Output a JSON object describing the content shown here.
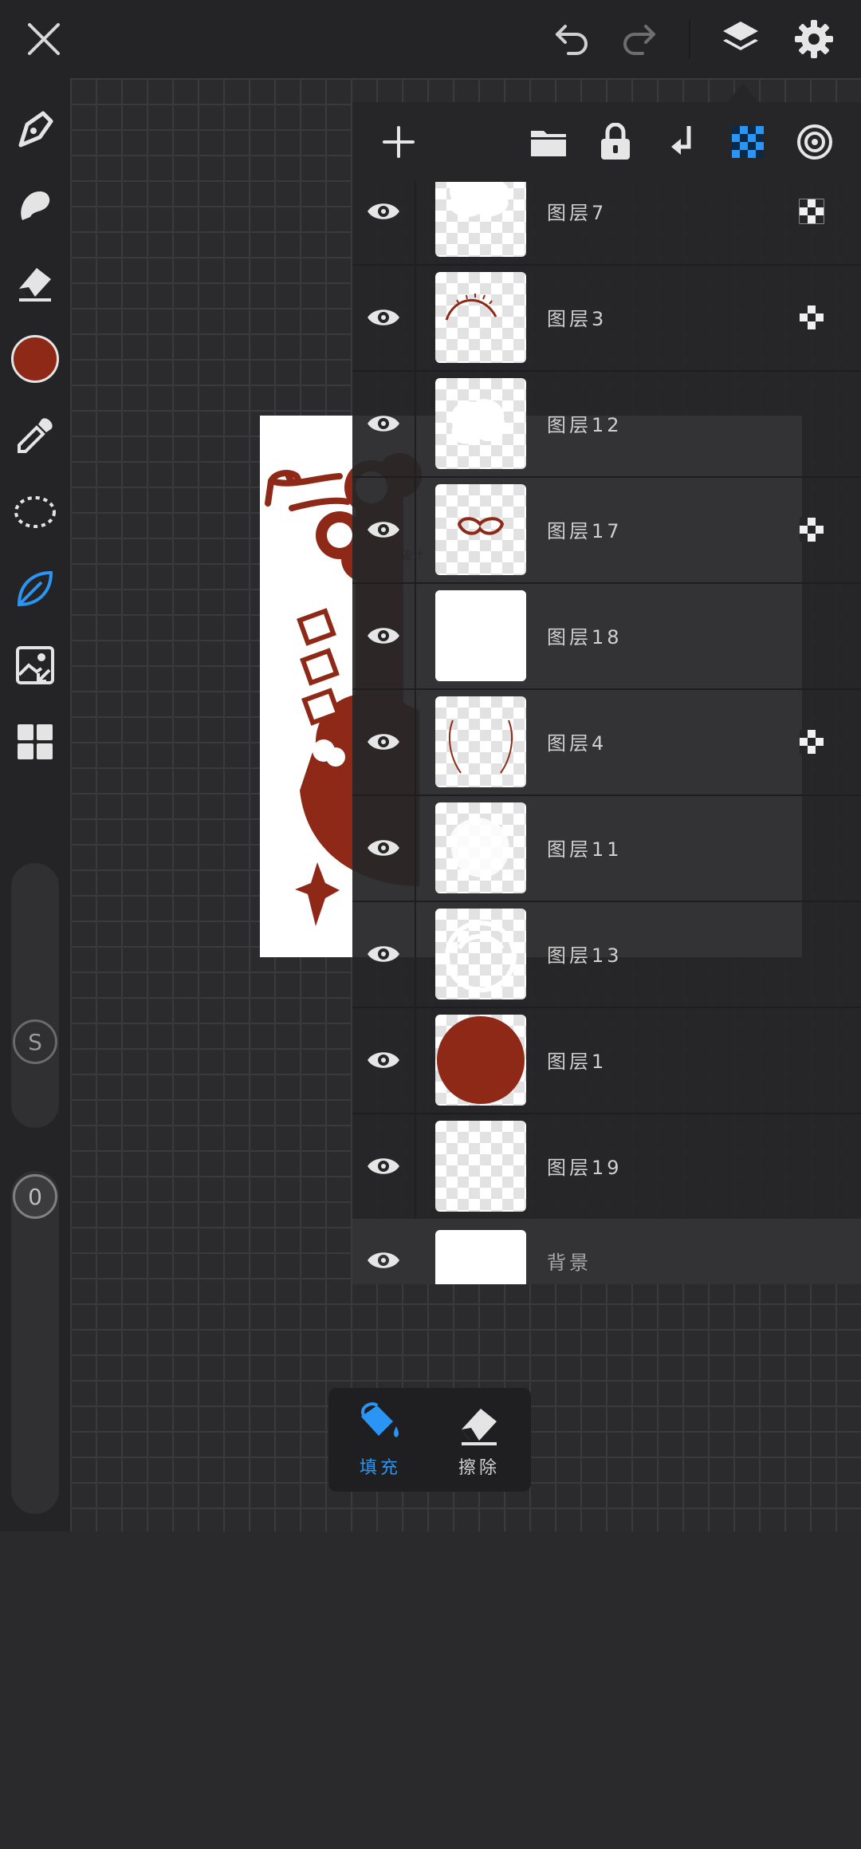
{
  "top_bar": {
    "icons": [
      "close-icon",
      "undo-icon",
      "redo-icon",
      "layers-icon",
      "settings-icon"
    ]
  },
  "colors": {
    "accent": "#2a95f4",
    "current_color": "#8e2817",
    "art_red": "#8e2817",
    "panel_bg": "#262628",
    "toolbar_bg": "#242426"
  },
  "left_toolbar": {
    "tools": [
      "brush-icon",
      "smudge-icon",
      "eraser-icon",
      "color-swatch",
      "eyedropper-icon",
      "lasso-select-icon",
      "leaf-fill-icon",
      "image-import-icon",
      "gallery-grid-icon"
    ],
    "size_slider_label": "S",
    "opacity_slider_label": "0"
  },
  "layers_panel": {
    "toolbar_icons": [
      "add-layer-icon",
      "folder-icon",
      "lock-icon",
      "merge-down-icon",
      "alpha-lock-icon",
      "layer-properties-icon"
    ],
    "layers": [
      {
        "name": "图层7",
        "alpha_locked": true
      },
      {
        "name": "图层3",
        "alpha_locked": true
      },
      {
        "name": "图层12",
        "alpha_locked": false
      },
      {
        "name": "图层17",
        "alpha_locked": true
      },
      {
        "name": "图层18",
        "alpha_locked": false
      },
      {
        "name": "图层4",
        "alpha_locked": true
      },
      {
        "name": "图层11",
        "alpha_locked": false
      },
      {
        "name": "图层13",
        "alpha_locked": false
      },
      {
        "name": "图层1",
        "alpha_locked": false
      },
      {
        "name": "图层19",
        "alpha_locked": false
      }
    ],
    "background_layer": {
      "name": "背景"
    }
  },
  "fill_bar": {
    "fill_label": "填充",
    "erase_label": "擦除"
  }
}
